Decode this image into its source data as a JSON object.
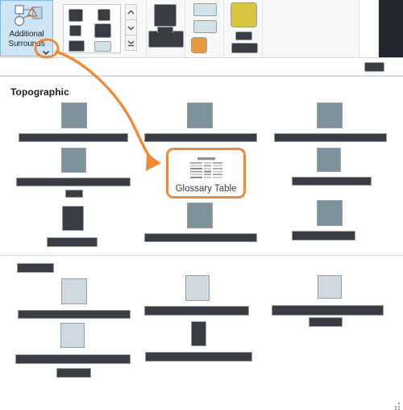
{
  "ribbon": {
    "additional_surrounds": {
      "label_line1": "Additional",
      "label_line2": "Surrounds",
      "icon": "shapes-surrounds-icon",
      "dropdown_icon": "chevron-down-icon"
    },
    "gallery": {
      "name": "surrounds-gallery",
      "scroll_up": "scroll-up-icon",
      "scroll_down": "scroll-down-icon",
      "expand": "expand-gallery-icon",
      "items": [
        {
          "name": "gallery-item-1",
          "style": "dark"
        },
        {
          "name": "gallery-item-2",
          "style": "dark"
        },
        {
          "name": "gallery-item-3",
          "style": "dark"
        },
        {
          "name": "gallery-item-4",
          "style": "dark"
        },
        {
          "name": "gallery-item-5",
          "style": "dark"
        },
        {
          "name": "gallery-item-6",
          "style": "pale"
        }
      ]
    },
    "segments": [
      {
        "name": "ribbon-segment-north-arrow"
      },
      {
        "name": "ribbon-segment-scale-bar"
      },
      {
        "name": "ribbon-segment-legend"
      },
      {
        "name": "ribbon-segment-text"
      },
      {
        "name": "ribbon-segment-extra"
      }
    ]
  },
  "panel": {
    "sections": [
      {
        "title": "Topographic",
        "name": "section-topographic",
        "items": [
          {
            "name": "surround-item-1",
            "thumb": "slate"
          },
          {
            "name": "surround-item-2",
            "thumb": "slate"
          },
          {
            "name": "surround-item-3",
            "thumb": "slate"
          },
          {
            "name": "surround-item-4",
            "thumb": "slate"
          },
          {
            "name": "surround-item-5",
            "thumb": "slate"
          },
          {
            "name": "surround-item-6",
            "thumb": "slate"
          },
          {
            "name": "surround-item-7",
            "thumb": "dark"
          },
          {
            "name": "surround-item-8",
            "thumb": "slate"
          },
          {
            "name": "surround-item-9",
            "thumb": "slate"
          }
        ]
      },
      {
        "title": "",
        "name": "section-secondary",
        "items": [
          {
            "name": "surround-item-10",
            "thumb": "pale"
          },
          {
            "name": "surround-item-11",
            "thumb": "pale"
          },
          {
            "name": "surround-item-12",
            "thumb": "pale"
          },
          {
            "name": "surround-item-13",
            "thumb": "pale"
          },
          {
            "name": "surround-item-14",
            "thumb": "pale"
          }
        ]
      }
    ],
    "highlighted_item": {
      "label": "Glossary Table",
      "name": "glossary-table-item",
      "icon": "table-icon"
    }
  },
  "annotation": {
    "highlight_color": "#ec8b3c",
    "circle_target": "additional-surrounds-dropdown-chevron",
    "arrow_target": "glossary-table-item"
  },
  "window": {
    "resize_grip": "resize-grip-icon"
  }
}
